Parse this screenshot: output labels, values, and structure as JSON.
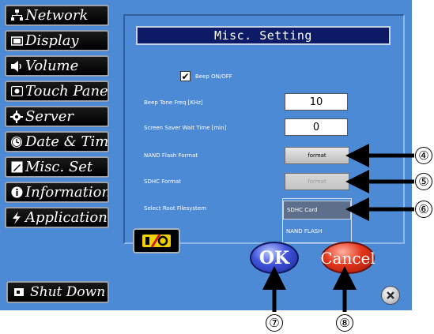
{
  "sidebar": {
    "items": [
      {
        "label": "Network",
        "icon": "network-icon"
      },
      {
        "label": "Display",
        "icon": "display-icon"
      },
      {
        "label": "Volume",
        "icon": "speaker-icon"
      },
      {
        "label": "Touch Panel",
        "icon": "touch-panel-icon"
      },
      {
        "label": "Server",
        "icon": "server-icon"
      },
      {
        "label": "Date & Time",
        "icon": "clock-icon"
      },
      {
        "label": "Misc. Set",
        "icon": "misc-icon"
      },
      {
        "label": "Information",
        "icon": "info-icon"
      },
      {
        "label": "Application",
        "icon": "lightning-icon"
      }
    ],
    "shutdown_label": "Shut Down"
  },
  "panel": {
    "title": "Misc. Setting",
    "beep_label": "Beep ON/OFF",
    "beep_checked": true,
    "beep_freq_label": "Beep Tone Freq [KHz]",
    "beep_freq_value": "10",
    "screensaver_label": "Screen Saver Wait Time [min]",
    "screensaver_value": "0",
    "nand_format_label": "NAND Flash Format",
    "nand_format_button": "format",
    "sdhc_format_label": "SDHC Format",
    "sdhc_format_button": "format",
    "root_fs_label": "Select Root Filesystem",
    "root_fs_options": [
      "SDHC Card",
      "NAND FLASH"
    ],
    "root_fs_selected": "SDHC Card"
  },
  "buttons": {
    "ok": "OK",
    "cancel": "Cancel"
  },
  "callouts": [
    "④",
    "⑤",
    "⑥",
    "⑦",
    "⑧"
  ],
  "colors": {
    "screen_bg": "#4d8ad6",
    "title_bg": "#0d1b66",
    "ok_blue": "#3f52d8",
    "cancel_red": "#e3361b"
  }
}
